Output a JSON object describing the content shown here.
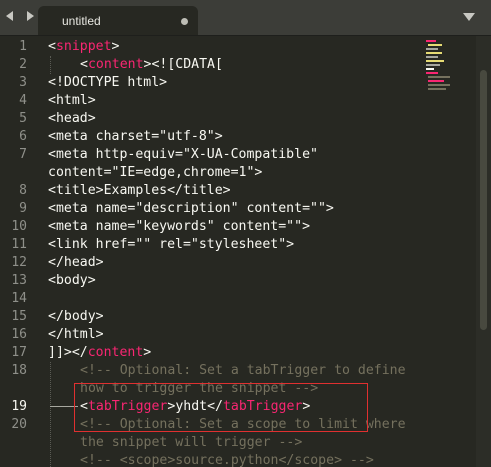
{
  "tab": {
    "title": "untitled"
  },
  "gutter": {
    "line_numbers": [
      "1",
      "2",
      "3",
      "4",
      "5",
      "6",
      "7",
      "",
      "8",
      "9",
      "10",
      "11",
      "12",
      "13",
      "14",
      "15",
      "16",
      "17",
      "18",
      "",
      "19",
      "20",
      "",
      ""
    ]
  },
  "code": {
    "l1_open": "<",
    "l1_tag": "snippet",
    "l1_close": ">",
    "l2_open": "<",
    "l2_tag": "content",
    "l2_rest": "><![CDATA[",
    "l3": "<!DOCTYPE html>",
    "l4": "<html>",
    "l5": "<head>",
    "l6": "<meta charset=\"utf-8\">",
    "l7a": "<meta http-equiv=\"X-UA-Compatible\"",
    "l7b": "content=\"IE=edge,chrome=1\">",
    "l8": "<title>Examples</title>",
    "l9": "<meta name=\"description\" content=\"\">",
    "l10": "<meta name=\"keywords\" content=\"\">",
    "l11": "<link href=\"\" rel=\"stylesheet\">",
    "l12": "</head>",
    "l13": "<body>",
    "l14": "",
    "l15": "</body>",
    "l16": "</html>",
    "l17_a": "]]></",
    "l17_tag": "content",
    "l17_b": ">",
    "l18a": "<!-- Optional: Set a tabTrigger to define",
    "l18b": "how to trigger the snippet -->",
    "l19_o1": "<",
    "l19_tag1": "tabTrigger",
    "l19_c1": ">",
    "l19_text": "yhdt",
    "l19_o2": "</",
    "l19_tag2": "tabTrigger",
    "l19_c2": ">",
    "l20a": "<!-- Optional: Set a scope to limit where",
    "l20b": "the snippet will trigger -->",
    "l21": "<!-- <scope>source.python</scope> -->"
  },
  "colors": {
    "background": "#272822",
    "tag": "#f92672",
    "string": "#e6db74",
    "comment": "#75715e",
    "highlight_box": "#e03030"
  },
  "icons": {
    "nav_back": "left-triangle-icon",
    "nav_forward": "right-triangle-icon",
    "tab_modified": "dot-icon",
    "tab_menu": "down-triangle-icon"
  }
}
